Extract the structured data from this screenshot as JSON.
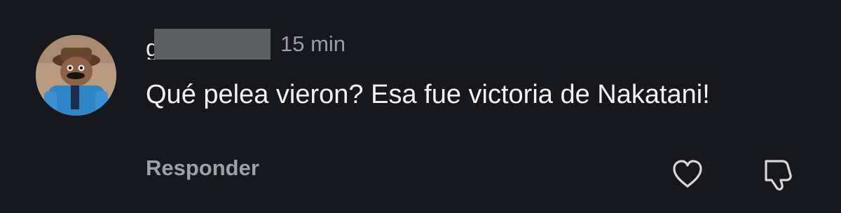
{
  "comment": {
    "username": "g",
    "time": "15 min",
    "text": "Qué pelea vieron? Esa fue victoria de Nakatani!",
    "reply_label": "Responder"
  },
  "icons": {
    "avatar": "user-avatar",
    "like": "heart-icon",
    "dislike": "thumbs-down-icon"
  },
  "colors": {
    "background": "#17181d",
    "text": "#f2f2f2",
    "muted": "#9ea0a6",
    "redaction": "#5d5f63"
  }
}
